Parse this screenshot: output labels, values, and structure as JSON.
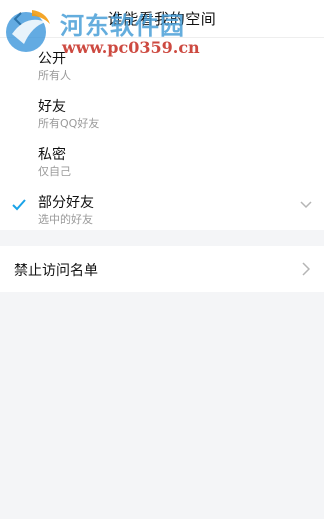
{
  "header": {
    "title": "谁能看我的空间",
    "back_icon": "chevron-left-icon"
  },
  "watermark": {
    "site_name": "河东软件园",
    "url": "www.pc0359.cn"
  },
  "options": [
    {
      "title": "公开",
      "subtitle": "所有人",
      "selected": false
    },
    {
      "title": "好友",
      "subtitle": "所有QQ好友",
      "selected": false
    },
    {
      "title": "私密",
      "subtitle": "仅自己",
      "selected": false
    },
    {
      "title": "部分好友",
      "subtitle": "选中的好友",
      "selected": true,
      "expand_icon": "chevron-down-icon"
    }
  ],
  "blocklist": {
    "label": "禁止访问名单",
    "icon": "chevron-right-icon"
  },
  "colors": {
    "accent": "#1aa3e8",
    "background": "#f4f5f7",
    "subtitle": "#9a9a9a"
  }
}
